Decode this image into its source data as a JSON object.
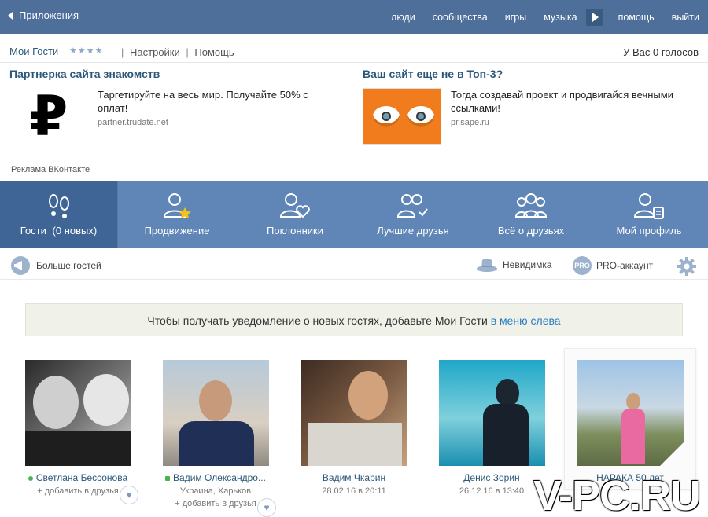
{
  "topbar": {
    "back_label": "Приложения",
    "nav": [
      "люди",
      "сообщества",
      "игры",
      "музыка",
      "помощь",
      "выйти"
    ]
  },
  "app": {
    "title": "Мои Гости",
    "stars": "★★★★",
    "settings_label": "Настройки",
    "help_label": "Помощь",
    "separator": "|",
    "votes": "У Вас 0 голосов"
  },
  "ads": [
    {
      "title": "Партнерка сайта знакомств",
      "text": "Таргетируйте на весь мир. Получайте 50% с оплат!",
      "url": "partner.trudate.net",
      "image_icon": "ruble-icon",
      "symbol": "₽"
    },
    {
      "title": "Ваш сайт еще не в Топ-3?",
      "text": "Тогда создавай проект и продвигайся вечными ссылками!",
      "url": "pr.sape.ru",
      "image_icon": "orange-eyes-icon"
    }
  ],
  "ad_label": "Реклама ВКонтакте",
  "tabs": [
    {
      "label": "Гости",
      "sub": "(0 новых)",
      "icon": "footprints-icon",
      "active": true
    },
    {
      "label": "Продвижение",
      "icon": "user-star-icon",
      "active": false
    },
    {
      "label": "Поклонники",
      "icon": "user-heart-icon",
      "active": false
    },
    {
      "label": "Лучшие друзья",
      "icon": "users-check-icon",
      "active": false
    },
    {
      "label": "Всё о друзьях",
      "icon": "group-icon",
      "active": false
    },
    {
      "label": "Мой профиль",
      "icon": "user-card-icon",
      "active": false
    }
  ],
  "subbar": {
    "more_guests": "Больше гостей",
    "invisible": "Невидимка",
    "pro_badge": "PRO",
    "pro": "PRO-аккаунт"
  },
  "notice": {
    "text": "Чтобы получать уведомление о новых гостях, добавьте Мои Гости",
    "link": "в меню слева"
  },
  "guests": [
    {
      "name": "Светлана Бессонова",
      "meta": "добавить в друзья",
      "online": true,
      "heart": true
    },
    {
      "name": "Вадим Олександро...",
      "meta": "Украина, Харьков",
      "meta2": "добавить в друзья",
      "online": true,
      "heart": true
    },
    {
      "name": "Вадим Чкарин",
      "meta": "28.02.16 в 20:11",
      "online": false,
      "heart": false
    },
    {
      "name": "Денис Зорин",
      "meta": "26.12.16 в 13:40",
      "online": false,
      "heart": false
    },
    {
      "name": "НАРАКА 50 лет",
      "meta": "",
      "online": false,
      "heart": false
    }
  ],
  "watermark": "V-PC.RU",
  "colors": {
    "topbar": "#4e6f99",
    "tabs": "#5f86b7",
    "tab_active": "#3e6595",
    "link": "#2b587a",
    "notice_link": "#2b7cc0"
  }
}
